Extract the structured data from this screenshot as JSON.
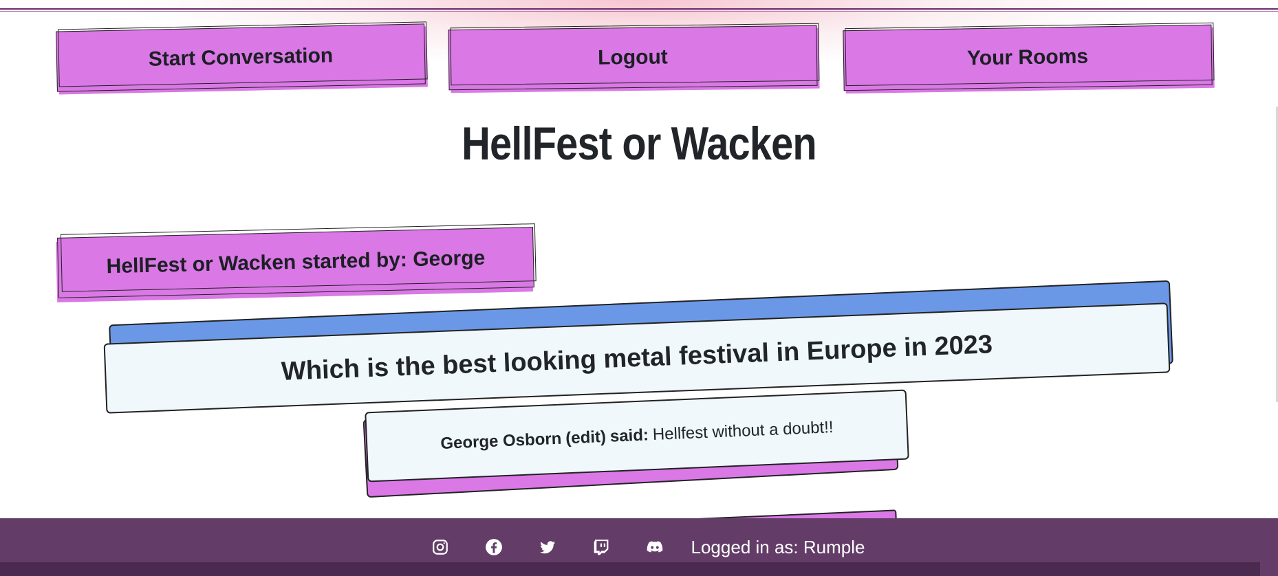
{
  "nav": {
    "start_label": "Start Conversation",
    "logout_label": "Logout",
    "rooms_label": "Your Rooms"
  },
  "page_title": "HellFest or Wacken",
  "room": {
    "header": "HellFest or Wacken started by: George",
    "question": "Which is the best looking metal festival in Europe in 2023"
  },
  "replies": [
    {
      "author": "George Osborn",
      "edit_label": "(edit)",
      "said": "said:",
      "text": "Hellfest without a doubt!!"
    }
  ],
  "footer": {
    "icons": [
      "instagram-icon",
      "facebook-icon",
      "twitter-icon",
      "twitch-icon",
      "discord-icon"
    ],
    "login_text": "Logged in as: Rumple"
  },
  "colors": {
    "accent_pink": "#da78e6",
    "accent_blue": "#6b98e6",
    "footer_bg": "#633d68",
    "card_bg": "#f0f8fc"
  }
}
